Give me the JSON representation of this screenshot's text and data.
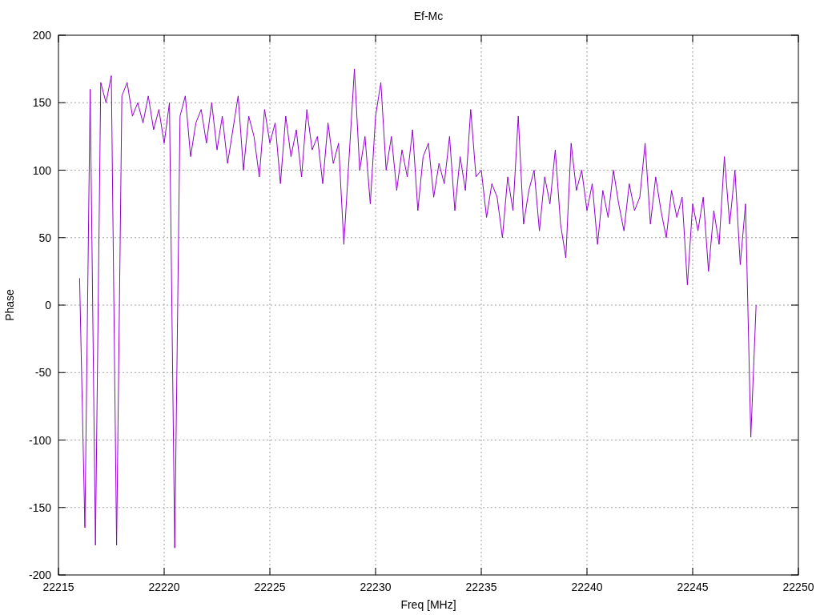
{
  "chart_data": {
    "type": "line",
    "grid": true,
    "title": "Ef-Mc",
    "xlabel": "Freq [MHz]",
    "ylabel": "Phase",
    "xlim": [
      22215,
      22250
    ],
    "ylim": [
      -200,
      200
    ],
    "xticks": [
      22215,
      22220,
      22225,
      22230,
      22235,
      22240,
      22245,
      22250
    ],
    "yticks": [
      -200,
      -150,
      -100,
      -50,
      0,
      50,
      100,
      150,
      200
    ],
    "x": [
      22216,
      22216.25,
      22216.5,
      22216.75,
      22217,
      22217.25,
      22217.5,
      22217.75,
      22218,
      22218.25,
      22218.5,
      22218.75,
      22219,
      22219.25,
      22219.5,
      22219.75,
      22220,
      22220.25,
      22220.5,
      22220.75,
      22221,
      22221.25,
      22221.5,
      22221.75,
      22222,
      22222.25,
      22222.5,
      22222.75,
      22223,
      22223.25,
      22223.5,
      22223.75,
      22224,
      22224.25,
      22224.5,
      22224.75,
      22225,
      22225.25,
      22225.5,
      22225.75,
      22226,
      22226.25,
      22226.5,
      22226.75,
      22227,
      22227.25,
      22227.5,
      22227.75,
      22228,
      22228.25,
      22228.5,
      22228.75,
      22229,
      22229.25,
      22229.5,
      22229.75,
      22230,
      22230.25,
      22230.5,
      22230.75,
      22231,
      22231.25,
      22231.5,
      22231.75,
      22232,
      22232.25,
      22232.5,
      22232.75,
      22233,
      22233.25,
      22233.5,
      22233.75,
      22234,
      22234.25,
      22234.5,
      22234.75,
      22235,
      22235.25,
      22235.5,
      22235.75,
      22236,
      22236.25,
      22236.5,
      22236.75,
      22237,
      22237.25,
      22237.5,
      22237.75,
      22238,
      22238.25,
      22238.5,
      22238.75,
      22239,
      22239.25,
      22239.5,
      22239.75,
      22240,
      22240.25,
      22240.5,
      22240.75,
      22241,
      22241.25,
      22241.5,
      22241.75,
      22242,
      22242.25,
      22242.5,
      22242.75,
      22243,
      22243.25,
      22243.5,
      22243.75,
      22244,
      22244.25,
      22244.5,
      22244.75,
      22245,
      22245.25,
      22245.5,
      22245.75,
      22246,
      22246.25,
      22246.5,
      22246.75,
      22247,
      22247.25,
      22247.5,
      22247.75,
      22248
    ],
    "series": [
      {
        "color": "#9400d3",
        "values": [
          20,
          -165,
          160,
          -178,
          165,
          150,
          170,
          -178,
          155,
          165,
          140,
          150,
          135,
          155,
          130,
          145,
          120,
          150,
          -180,
          140,
          155,
          110,
          135,
          145,
          120,
          150,
          115,
          140,
          105,
          130,
          155,
          100,
          140,
          125,
          95,
          145,
          120,
          135,
          90,
          140,
          110,
          130,
          95,
          145,
          115,
          125,
          90,
          135,
          105,
          120,
          45,
          110,
          175,
          100,
          125,
          75,
          140,
          165,
          100,
          125,
          85,
          115,
          95,
          130,
          70,
          110,
          120,
          80,
          105,
          90,
          125,
          70,
          110,
          85,
          145,
          95,
          100,
          65,
          90,
          80,
          50,
          95,
          70,
          140,
          60,
          85,
          100,
          55,
          95,
          75,
          115,
          60,
          35,
          120,
          85,
          100,
          70,
          90,
          45,
          85,
          65,
          100,
          75,
          55,
          90,
          70,
          80,
          120,
          60,
          95,
          70,
          50,
          85,
          65,
          80,
          15,
          75,
          55,
          80,
          25,
          70,
          45,
          110,
          60,
          100,
          30,
          75,
          -98,
          0
        ]
      }
    ]
  }
}
